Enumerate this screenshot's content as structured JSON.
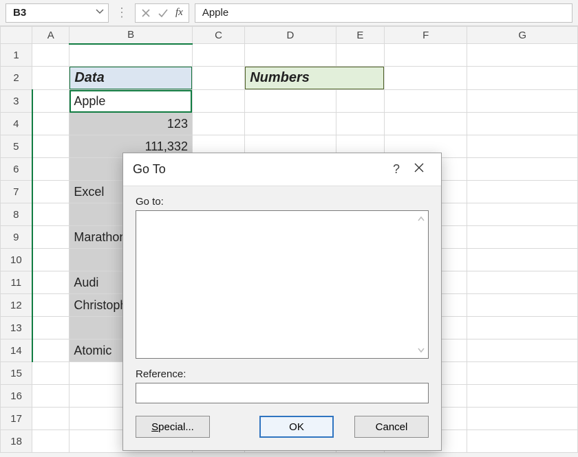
{
  "namebox": {
    "value": "B3"
  },
  "formula_bar": {
    "value": "Apple"
  },
  "columns": [
    "A",
    "B",
    "C",
    "D",
    "E",
    "F",
    "G"
  ],
  "rows_shown": 18,
  "cells": {
    "B2": "Data",
    "D2": "Numbers",
    "B3": "Apple",
    "B4": "123",
    "B5": "111,332",
    "B7": "Excel",
    "B9": "Marathon",
    "B11": "Audi",
    "B12": "Christopher",
    "B14": "Atomic"
  },
  "selected_range": {
    "start": "B3",
    "end": "B14",
    "active": "B3"
  },
  "dialog": {
    "title": "Go To",
    "label_goto": "Go to:",
    "label_reference": "Reference:",
    "reference_value": "",
    "buttons": {
      "special": "Special...",
      "ok": "OK",
      "cancel": "Cancel"
    }
  }
}
